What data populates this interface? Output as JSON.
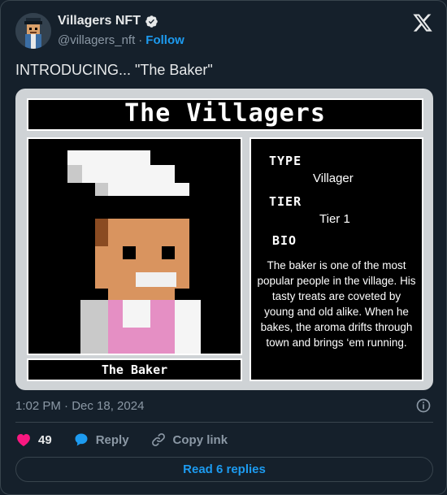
{
  "author": {
    "display_name": "Villagers NFT",
    "handle": "@villagers_nft",
    "separator": "·",
    "follow_label": "Follow",
    "verified": true
  },
  "tweet": {
    "text": "INTRODUCING... \"The Baker\""
  },
  "card": {
    "title": "The Villagers",
    "caption": "The Baker",
    "type_label": "TYPE",
    "type_value": "Villager",
    "tier_label": "TIER",
    "tier_value": "Tier 1",
    "bio_label": "BIO",
    "bio_text": "The baker is one of the most popular people in the village. His tasty treats are coveted by young and old alike. When he bakes, the aroma drifts through town and brings ‘em running."
  },
  "meta": {
    "timestamp": "1:02 PM · Dec 18, 2024"
  },
  "actions": {
    "like_count": "49",
    "reply_label": "Reply",
    "copy_link_label": "Copy link"
  },
  "read_replies_label": "Read 6 replies",
  "colors": {
    "accent": "#1d9bf0",
    "like": "#f91880",
    "background": "#15202b"
  }
}
